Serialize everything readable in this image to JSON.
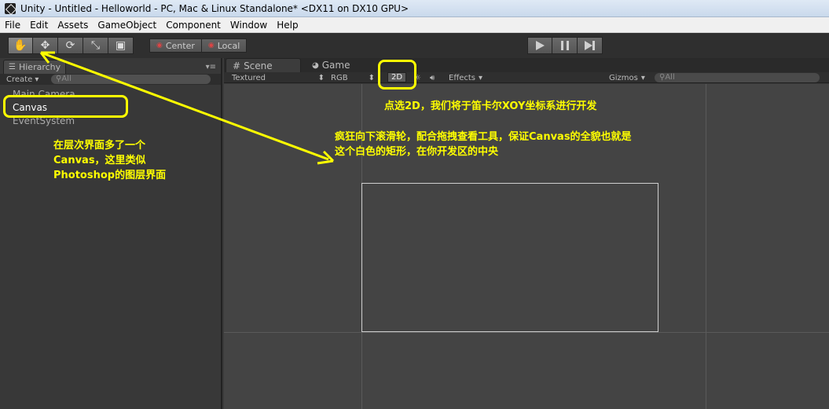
{
  "window": {
    "title": "Unity - Untitled - Helloworld - PC, Mac & Linux Standalone* <DX11 on DX10 GPU>"
  },
  "menu": {
    "items": [
      "File",
      "Edit",
      "Assets",
      "GameObject",
      "Component",
      "Window",
      "Help"
    ]
  },
  "toolbar": {
    "tools": [
      {
        "name": "hand-tool",
        "icon": "hand-icon",
        "glyph": "✋",
        "active": true
      },
      {
        "name": "move-tool",
        "icon": "move-icon",
        "glyph": "✥",
        "active": false
      },
      {
        "name": "rotate-tool",
        "icon": "rotate-icon",
        "glyph": "⟳",
        "active": false
      },
      {
        "name": "scale-tool",
        "icon": "scale-icon",
        "glyph": "⤡",
        "active": false
      },
      {
        "name": "rect-tool",
        "icon": "rect-icon",
        "glyph": "▣",
        "active": false
      }
    ],
    "pivot_label": "Center",
    "space_label": "Local",
    "play_icons": [
      "play-icon",
      "pause-icon",
      "step-icon"
    ]
  },
  "hierarchy": {
    "tab_label": "Hierarchy",
    "create_label": "Create",
    "search_placeholder": "All",
    "items": [
      {
        "label": "Main Camera",
        "selected": false
      },
      {
        "label": "Canvas",
        "selected": true
      },
      {
        "label": "EventSystem",
        "selected": false
      }
    ]
  },
  "scene": {
    "tabs": [
      {
        "label": "Scene",
        "active": true
      },
      {
        "label": "Game",
        "active": false
      }
    ],
    "toolbar": {
      "shading_mode": "Textured",
      "render_mode": "RGB",
      "mode_2d": "2D",
      "effects_label": "Effects",
      "gizmos_label": "Gizmos",
      "search_placeholder": "All"
    }
  },
  "annotations": {
    "hierarchy_note": "在层次界面多了一个\nCanvas，这里类似\nPhotoshop的图层界面",
    "mode_2d_note": "点选2D，我们将于笛卡尔XOY坐标系进行开发",
    "scroll_note": "疯狂向下滚滑轮，配合拖拽查看工具，保证Canvas的全貌也就是\n这个白色的矩形，在你开发区的中央",
    "color": "#ffff00"
  }
}
